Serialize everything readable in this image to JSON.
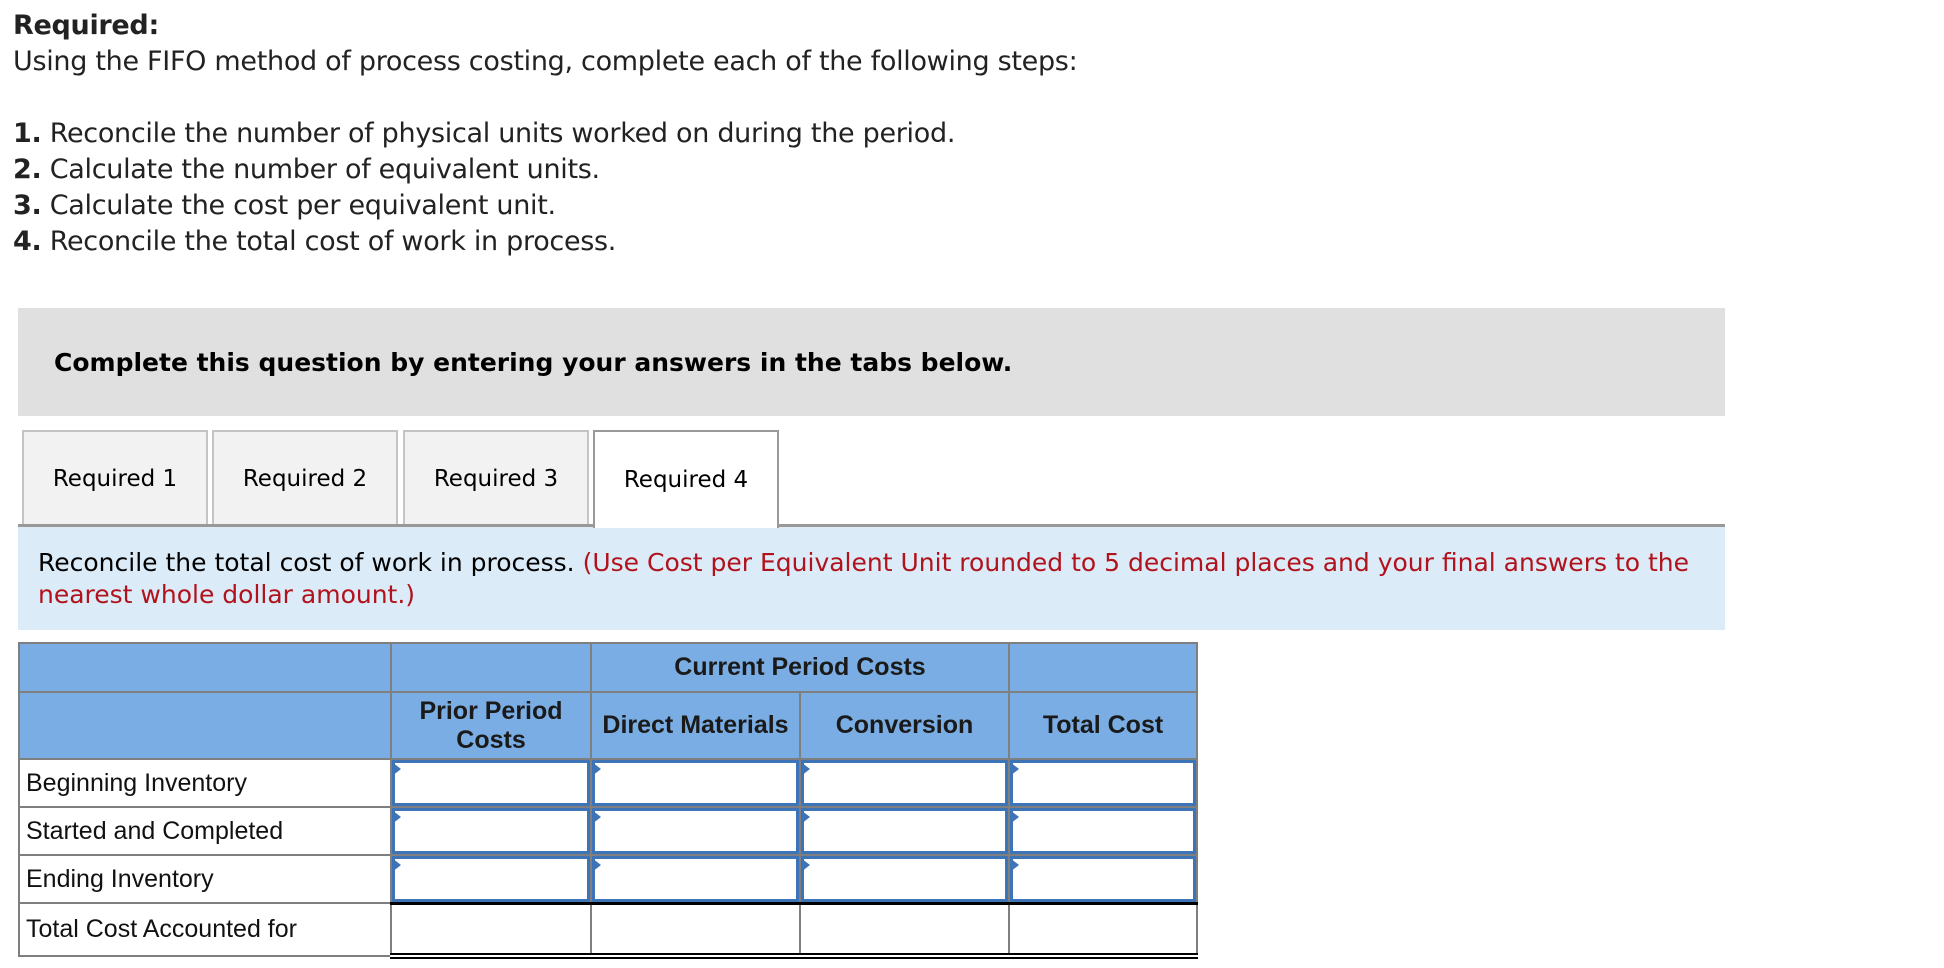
{
  "intro": {
    "title": "Required:",
    "instruction": "Using the FIFO method of process costing, complete each of the following steps:",
    "steps": [
      {
        "num": "1.",
        "text": " Reconcile the number of physical units worked on during the period."
      },
      {
        "num": "2.",
        "text": " Calculate the number of equivalent units."
      },
      {
        "num": "3.",
        "text": " Calculate the cost per equivalent unit."
      },
      {
        "num": "4.",
        "text": " Reconcile the total cost of work in process."
      }
    ]
  },
  "instruction_box": {
    "text": "Complete this question by entering your answers in the tabs below."
  },
  "tabs": [
    {
      "label": "Required 1",
      "active": false
    },
    {
      "label": "Required 2",
      "active": false
    },
    {
      "label": "Required 3",
      "active": false
    },
    {
      "label": "Required 4",
      "active": true
    }
  ],
  "info": {
    "text": "Reconcile the total cost of work in process. ",
    "note": "(Use Cost per Equivalent Unit rounded to 5 decimal places and your final answers to the nearest whole dollar amount.)"
  },
  "table": {
    "group_header": "Current Period Costs",
    "columns": [
      "Prior Period Costs",
      "Direct Materials",
      "Conversion",
      "Total Cost"
    ],
    "rows": [
      {
        "label": "Beginning Inventory",
        "values": [
          "",
          "",
          "",
          ""
        ]
      },
      {
        "label": "Started and Completed",
        "values": [
          "",
          "",
          "",
          ""
        ]
      },
      {
        "label": "Ending Inventory",
        "values": [
          "",
          "",
          "",
          ""
        ]
      }
    ],
    "total_row": {
      "label": "Total Cost Accounted for",
      "values": [
        "",
        "",
        "",
        ""
      ]
    }
  },
  "colors": {
    "header_blue": "#7aade3",
    "input_border": "#3d74b7",
    "note_red": "#b1121b",
    "info_bg": "#dbebf8",
    "instruction_bg": "#e0e0e0"
  }
}
